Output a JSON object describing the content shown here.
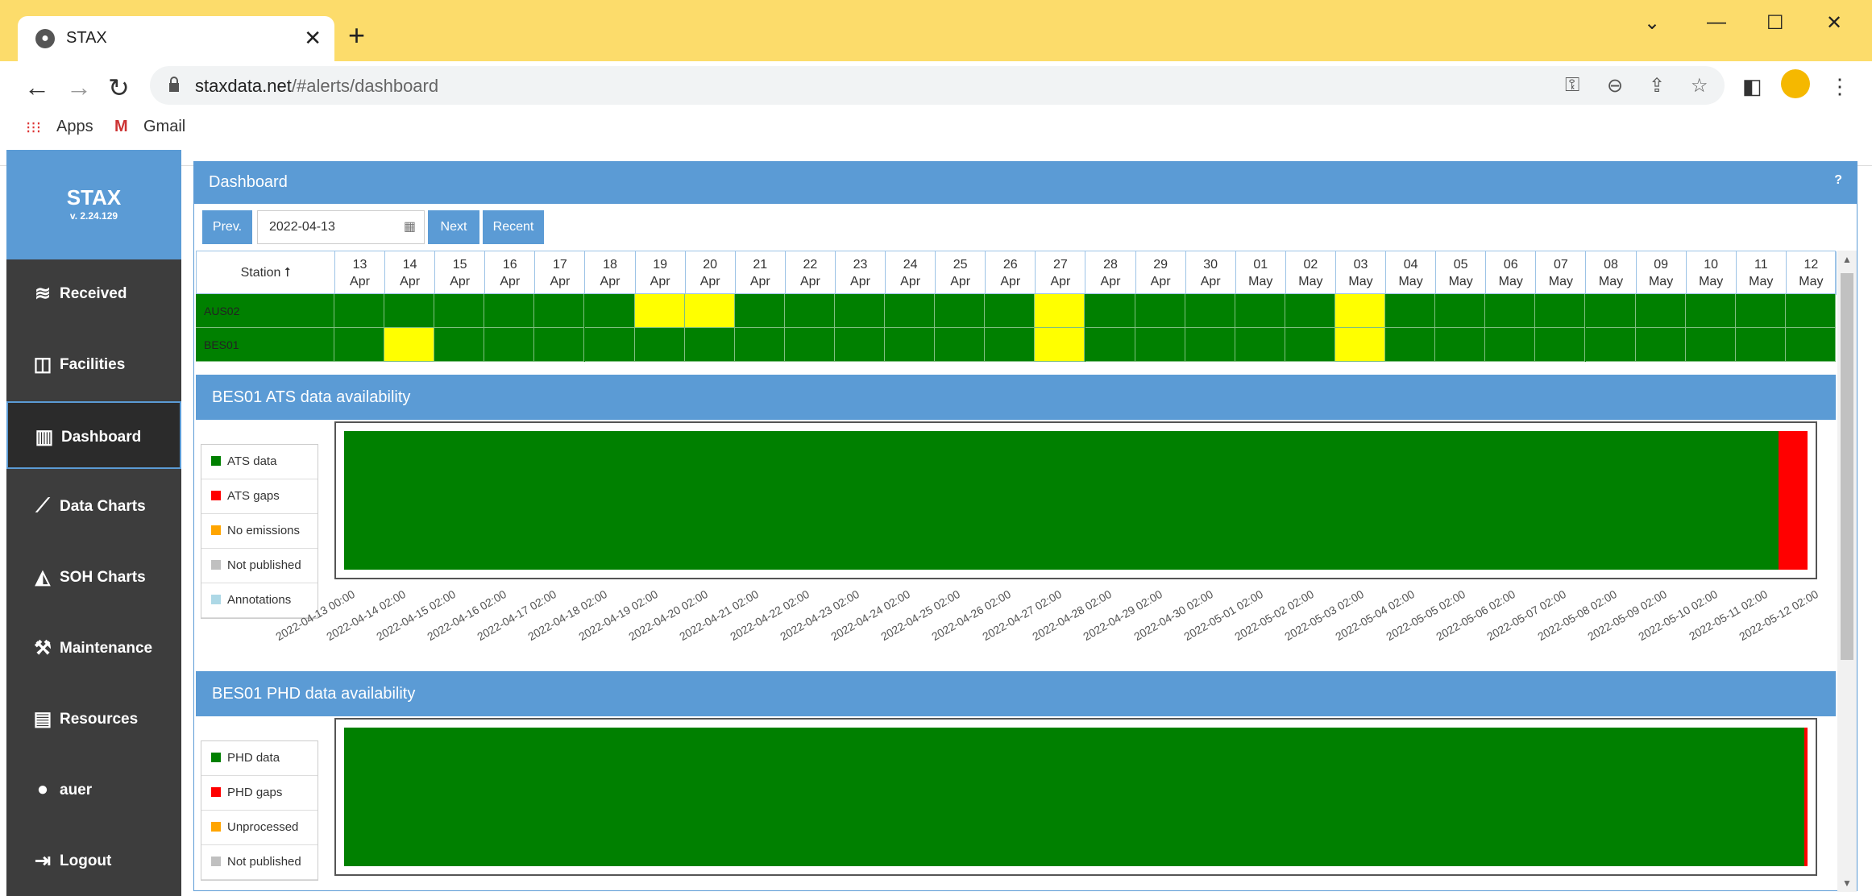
{
  "browser": {
    "tab_title": "STAX",
    "url_host": "staxdata.net",
    "url_path": "/#alerts/dashboard",
    "bookmarks": [
      "Apps",
      "Gmail"
    ]
  },
  "app": {
    "brand": "STAX",
    "version": "v. 2.24.129",
    "nav": [
      {
        "label": "Received",
        "icon": "database-icon"
      },
      {
        "label": "Facilities",
        "icon": "columns-icon"
      },
      {
        "label": "Dashboard",
        "icon": "bar-chart-icon",
        "active": true
      },
      {
        "label": "Data Charts",
        "icon": "line-chart-icon"
      },
      {
        "label": "SOH Charts",
        "icon": "area-chart-icon"
      },
      {
        "label": "Maintenance",
        "icon": "wrench-icon"
      },
      {
        "label": "Resources",
        "icon": "book-icon"
      },
      {
        "label": "auer",
        "icon": "user-icon"
      },
      {
        "label": "Logout",
        "icon": "logout-icon"
      }
    ]
  },
  "dashboard": {
    "title": "Dashboard",
    "help": "?",
    "prev_label": "Prev.",
    "date_value": "2022-04-13",
    "next_label": "Next",
    "recent_label": "Recent",
    "station_header": "Station",
    "days": [
      [
        "13",
        "Apr"
      ],
      [
        "14",
        "Apr"
      ],
      [
        "15",
        "Apr"
      ],
      [
        "16",
        "Apr"
      ],
      [
        "17",
        "Apr"
      ],
      [
        "18",
        "Apr"
      ],
      [
        "19",
        "Apr"
      ],
      [
        "20",
        "Apr"
      ],
      [
        "21",
        "Apr"
      ],
      [
        "22",
        "Apr"
      ],
      [
        "23",
        "Apr"
      ],
      [
        "24",
        "Apr"
      ],
      [
        "25",
        "Apr"
      ],
      [
        "26",
        "Apr"
      ],
      [
        "27",
        "Apr"
      ],
      [
        "28",
        "Apr"
      ],
      [
        "29",
        "Apr"
      ],
      [
        "30",
        "Apr"
      ],
      [
        "01",
        "May"
      ],
      [
        "02",
        "May"
      ],
      [
        "03",
        "May"
      ],
      [
        "04",
        "May"
      ],
      [
        "05",
        "May"
      ],
      [
        "06",
        "May"
      ],
      [
        "07",
        "May"
      ],
      [
        "08",
        "May"
      ],
      [
        "09",
        "May"
      ],
      [
        "10",
        "May"
      ],
      [
        "11",
        "May"
      ],
      [
        "12",
        "May"
      ]
    ],
    "stations": [
      {
        "name": "AUS02",
        "yellow_days": [
          6,
          7,
          14,
          20
        ]
      },
      {
        "name": "BES01",
        "yellow_days": [
          1,
          14,
          20
        ]
      }
    ],
    "colors": {
      "ok": "#008000",
      "warn": "#ffff00",
      "gap": "#ff0000",
      "accent": "#5b9bd5"
    }
  },
  "ats": {
    "title": "BES01 ATS data availability",
    "legend": [
      {
        "label": "ATS data",
        "color": "#008000"
      },
      {
        "label": "ATS gaps",
        "color": "#ff0000"
      },
      {
        "label": "No emissions",
        "color": "#ffa500"
      },
      {
        "label": "Not published",
        "color": "#c0c0c0"
      },
      {
        "label": "Annotations",
        "color": "#add8e6"
      }
    ],
    "data_fraction": 0.98,
    "ticks": [
      "2022-04-13 00:00",
      "2022-04-14 02:00",
      "2022-04-15 02:00",
      "2022-04-16 02:00",
      "2022-04-17 02:00",
      "2022-04-18 02:00",
      "2022-04-19 02:00",
      "2022-04-20 02:00",
      "2022-04-21 02:00",
      "2022-04-22 02:00",
      "2022-04-23 02:00",
      "2022-04-24 02:00",
      "2022-04-25 02:00",
      "2022-04-26 02:00",
      "2022-04-27 02:00",
      "2022-04-28 02:00",
      "2022-04-29 02:00",
      "2022-04-30 02:00",
      "2022-05-01 02:00",
      "2022-05-02 02:00",
      "2022-05-03 02:00",
      "2022-05-04 02:00",
      "2022-05-05 02:00",
      "2022-05-06 02:00",
      "2022-05-07 02:00",
      "2022-05-08 02:00",
      "2022-05-09 02:00",
      "2022-05-10 02:00",
      "2022-05-11 02:00",
      "2022-05-12 02:00"
    ]
  },
  "phd": {
    "title": "BES01 PHD data availability",
    "legend": [
      {
        "label": "PHD data",
        "color": "#008000"
      },
      {
        "label": "PHD gaps",
        "color": "#ff0000"
      },
      {
        "label": "Unprocessed",
        "color": "#ffa500"
      },
      {
        "label": "Not published",
        "color": "#c0c0c0"
      }
    ],
    "data_fraction": 0.998
  }
}
